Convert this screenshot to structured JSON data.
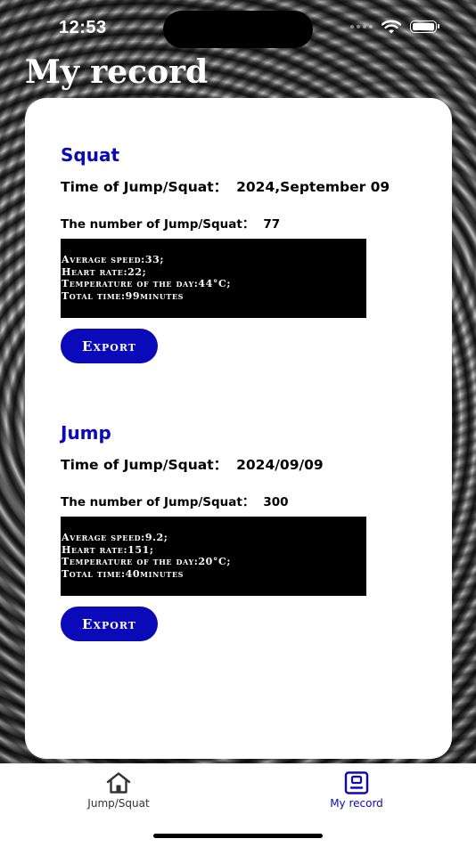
{
  "status_bar": {
    "time": "12:53"
  },
  "page": {
    "title": "My record"
  },
  "records": [
    {
      "type": "Squat",
      "time_label": "Time of Jump/Squat：",
      "time_value": "2024,September 09",
      "count_label": "The number of Jump/Squat：",
      "count_value": "77",
      "stats": {
        "speed": "Average speed:33;",
        "heart_rate": "Heart rate:22;",
        "temperature": "Temperature of the day:44°C;",
        "total_time": "Total time:99minutes"
      },
      "export_label": "Export"
    },
    {
      "type": "Jump",
      "time_label": "Time of Jump/Squat：",
      "time_value": "2024/09/09",
      "count_label": "The number of Jump/Squat：",
      "count_value": "300",
      "stats": {
        "speed": "Average speed:9.2;",
        "heart_rate": "Heart rate:151;",
        "temperature": "Temperature of the day:20°C;",
        "total_time": "Total time:40minutes"
      },
      "export_label": "Export"
    }
  ],
  "tab_bar": {
    "tabs": [
      {
        "label": "Jump/Squat",
        "icon": "home-icon",
        "active": false
      },
      {
        "label": "My record",
        "icon": "record-icon",
        "active": true
      }
    ],
    "active_color": "#0a0ab8"
  }
}
